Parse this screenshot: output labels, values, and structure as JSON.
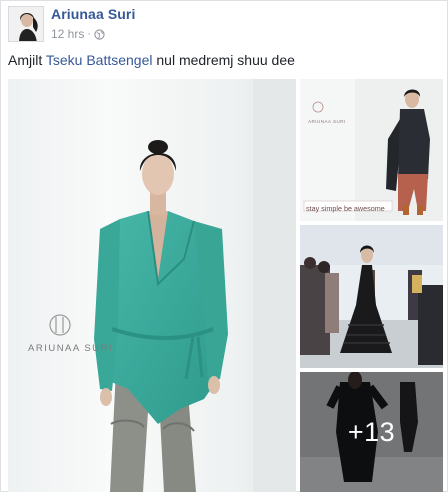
{
  "post": {
    "author": "Ariunaa Suri",
    "time": "12 hrs",
    "privacy_icon": "public-globe-icon",
    "text_before": "Amjilt ",
    "mention": "Tseku Battsengel",
    "text_after": " nul medremj shuu dee"
  },
  "photos": {
    "main_brand": "ARIUNAA SURI",
    "top_right_brand": "ARIUNAA SURI",
    "top_right_tagline": "stay simple be awesome",
    "more_count": "+13"
  },
  "colors": {
    "link": "#365899",
    "meta": "#90949c",
    "blouse": "#3dae9f"
  }
}
